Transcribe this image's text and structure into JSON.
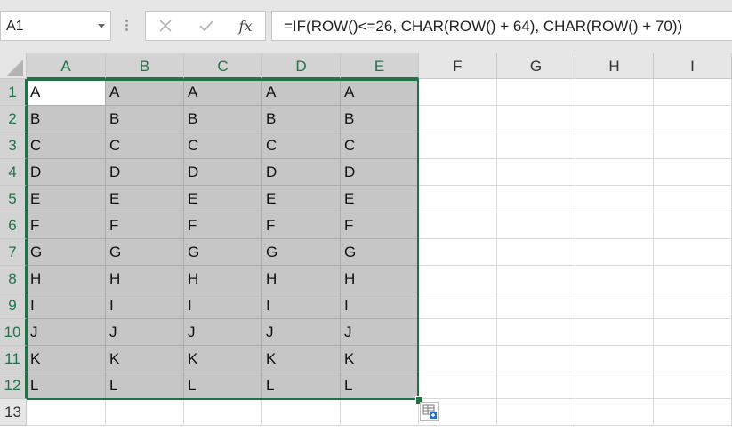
{
  "formula_bar": {
    "name_box": "A1",
    "formula": "=IF(ROW()<=26, CHAR(ROW() + 64), CHAR(ROW() + 70))",
    "fx_label": "fx",
    "cancel_icon": "close-icon",
    "enter_icon": "check-icon",
    "name_box_arrow_icon": "chevron-down-icon"
  },
  "columns": [
    "A",
    "B",
    "C",
    "D",
    "E",
    "F",
    "G",
    "H",
    "I"
  ],
  "rows": [
    "1",
    "2",
    "3",
    "4",
    "5",
    "6",
    "7",
    "8",
    "9",
    "10",
    "11",
    "12",
    "13"
  ],
  "cells": [
    [
      "A",
      "A",
      "A",
      "A",
      "A"
    ],
    [
      "B",
      "B",
      "B",
      "B",
      "B"
    ],
    [
      "C",
      "C",
      "C",
      "C",
      "C"
    ],
    [
      "D",
      "D",
      "D",
      "D",
      "D"
    ],
    [
      "E",
      "E",
      "E",
      "E",
      "E"
    ],
    [
      "F",
      "F",
      "F",
      "F",
      "F"
    ],
    [
      "G",
      "G",
      "G",
      "G",
      "G"
    ],
    [
      "H",
      "H",
      "H",
      "H",
      "H"
    ],
    [
      "I",
      "I",
      "I",
      "I",
      "I"
    ],
    [
      "J",
      "J",
      "J",
      "J",
      "J"
    ],
    [
      "K",
      "K",
      "K",
      "K",
      "K"
    ],
    [
      "L",
      "L",
      "L",
      "L",
      "L"
    ]
  ],
  "selection": {
    "range": "A1:E12",
    "active_cell": "A1"
  },
  "quick_analysis_icon": "quick-analysis-icon",
  "colors": {
    "selection_border": "#217346",
    "selected_fill": "#c6c6c6",
    "header_bg": "#e6e6e6"
  }
}
